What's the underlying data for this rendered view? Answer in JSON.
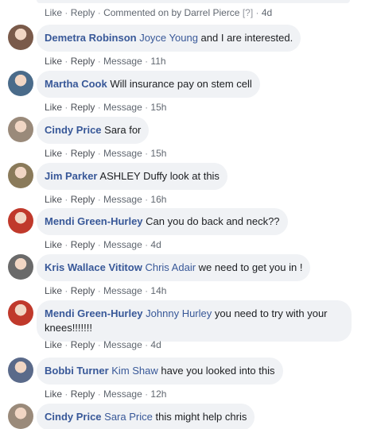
{
  "top": {
    "like": "Like",
    "reply": "Reply",
    "commented_on_by": "Commented on by Darrel Pierce",
    "help_mark": "[?]",
    "time": "4d"
  },
  "comments": [
    {
      "author": "Demetra Robinson",
      "mention": "Joyce Young",
      "text": " and I are interested.",
      "like": "Like",
      "reply": "Reply",
      "message": "Message",
      "time": "11h",
      "avatar_color": "#7a5a4a"
    },
    {
      "author": "Martha Cook",
      "mention": "",
      "text": " Will insurance pay on stem cell",
      "like": "Like",
      "reply": "Reply",
      "message": "Message",
      "time": "15h",
      "avatar_color": "#4a6b8a"
    },
    {
      "author": "Cindy Price",
      "mention": "",
      "text": " Sara for",
      "like": "Like",
      "reply": "Reply",
      "message": "Message",
      "time": "15h",
      "avatar_color": "#9a8a7a"
    },
    {
      "author": "Jim Parker",
      "mention": "",
      "text": " ASHLEY Duffy look at this",
      "like": "Like",
      "reply": "Reply",
      "message": "Message",
      "time": "16h",
      "avatar_color": "#8a7a5a"
    },
    {
      "author": "Mendi Green-Hurley",
      "mention": "",
      "text": " Can you do back and neck??",
      "like": "Like",
      "reply": "Reply",
      "message": "Message",
      "time": "4d",
      "avatar_color": "#c0392b"
    },
    {
      "author": "Kris Wallace Vititow",
      "mention": "Chris Adair",
      "text": " we need to get you in !",
      "like": "Like",
      "reply": "Reply",
      "message": "Message",
      "time": "14h",
      "avatar_color": "#6a6a6a"
    },
    {
      "author": "Mendi Green-Hurley",
      "mention": "Johnny Hurley",
      "text": " you need to try with your knees!!!!!!!",
      "like": "Like",
      "reply": "Reply",
      "message": "Message",
      "time": "4d",
      "avatar_color": "#c0392b"
    },
    {
      "author": "Bobbi Turner",
      "mention": "Kim Shaw",
      "text": " have you looked into this",
      "like": "Like",
      "reply": "Reply",
      "message": "Message",
      "time": "12h",
      "avatar_color": "#5a6a8a"
    },
    {
      "author": "Cindy Price",
      "mention": "Sara Price",
      "text": " this might help chris",
      "like": "Like",
      "reply": "Reply",
      "message": "",
      "time": "",
      "avatar_color": "#9a8a7a"
    }
  ]
}
